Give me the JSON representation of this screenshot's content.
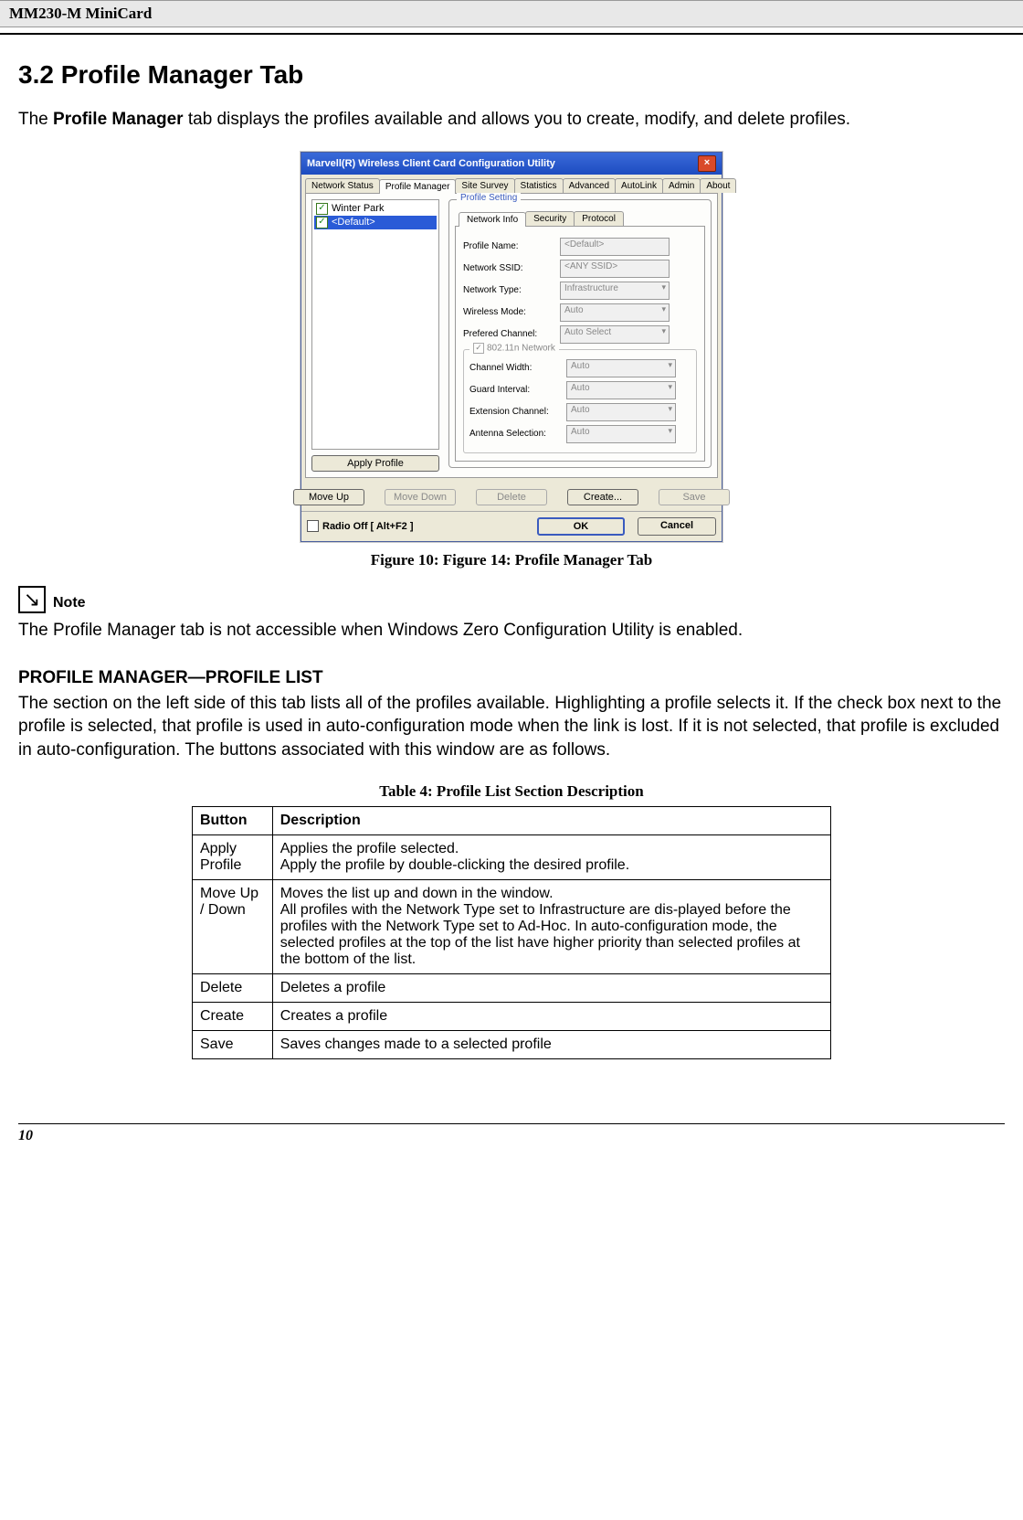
{
  "header": {
    "doc_title": "MM230-M MiniCard"
  },
  "section": {
    "title": "3.2 Profile Manager Tab",
    "intro_prefix": "The ",
    "intro_bold": "Profile Manager",
    "intro_suffix": " tab displays the profiles available and allows you to create, modify, and delete profiles."
  },
  "dialog": {
    "title": "Marvell(R) Wireless Client Card Configuration Utility",
    "tabs": [
      "Network Status",
      "Profile Manager",
      "Site Survey",
      "Statistics",
      "Advanced",
      "AutoLink",
      "Admin",
      "About"
    ],
    "active_tab_index": 1,
    "profiles": [
      {
        "checked": true,
        "label": "Winter Park",
        "selected": false
      },
      {
        "checked": true,
        "label": "<Default>",
        "selected": true
      }
    ],
    "apply_profile_btn": "Apply Profile",
    "group_title": "Profile Setting",
    "subtabs": [
      "Network Info",
      "Security",
      "Protocol"
    ],
    "active_subtab_index": 0,
    "form": {
      "profile_name": {
        "label": "Profile Name:",
        "value": "<Default>"
      },
      "network_ssid": {
        "label": "Network SSID:",
        "value": "<ANY SSID>"
      },
      "network_type": {
        "label": "Network Type:",
        "value": "Infrastructure"
      },
      "wireless_mode": {
        "label": "Wireless Mode:",
        "value": "Auto"
      },
      "preferred_channel": {
        "label": "Prefered Channel:",
        "value": "Auto Select"
      },
      "n_group_label": "802.11n Network",
      "channel_width": {
        "label": "Channel Width:",
        "value": "Auto"
      },
      "guard_interval": {
        "label": "Guard Interval:",
        "value": "Auto"
      },
      "extension_channel": {
        "label": "Extension Channel:",
        "value": "Auto"
      },
      "antenna_selection": {
        "label": "Antenna Selection:",
        "value": "Auto"
      }
    },
    "buttons": {
      "move_up": "Move Up",
      "move_down": "Move Down",
      "delete": "Delete",
      "create": "Create...",
      "save": "Save"
    },
    "radio_off": "Radio Off  [ Alt+F2 ]",
    "ok": "OK",
    "cancel": "Cancel"
  },
  "figure_caption": "Figure 10: Figure 14: Profile Manager Tab",
  "note": {
    "label": "Note",
    "text": "The Profile Manager tab is not accessible when Windows Zero Configuration Utility is enabled."
  },
  "profile_list_section": {
    "heading": "PROFILE MANAGER—PROFILE LIST",
    "para": "The section on the left side of this tab lists all of the profiles available. Highlighting a profile selects it. If the check box next to the profile is selected, that profile is used in auto-configuration mode when the link is lost. If it is not selected, that profile is excluded in auto-configuration. The buttons associated with this window are as follows."
  },
  "table": {
    "caption": "Table 4: Profile List Section Description",
    "headers": [
      "Button",
      "Description"
    ],
    "rows": [
      {
        "button": "Apply Profile",
        "desc": "Applies the profile selected.\nApply the profile by double-clicking the desired profile."
      },
      {
        "button": "Move Up / Down",
        "desc": "Moves the list up and down in the window.\nAll profiles with the Network Type set to Infrastructure are dis-played before the profiles with the Network Type set to Ad-Hoc. In auto-configuration mode, the selected profiles at the top of the list have higher priority than selected profiles at the bottom of the list."
      },
      {
        "button": "Delete",
        "desc": "Deletes a profile"
      },
      {
        "button": "Create",
        "desc": "Creates a profile"
      },
      {
        "button": "Save",
        "desc": "Saves changes made to a selected profile"
      }
    ]
  },
  "page_number": "10"
}
